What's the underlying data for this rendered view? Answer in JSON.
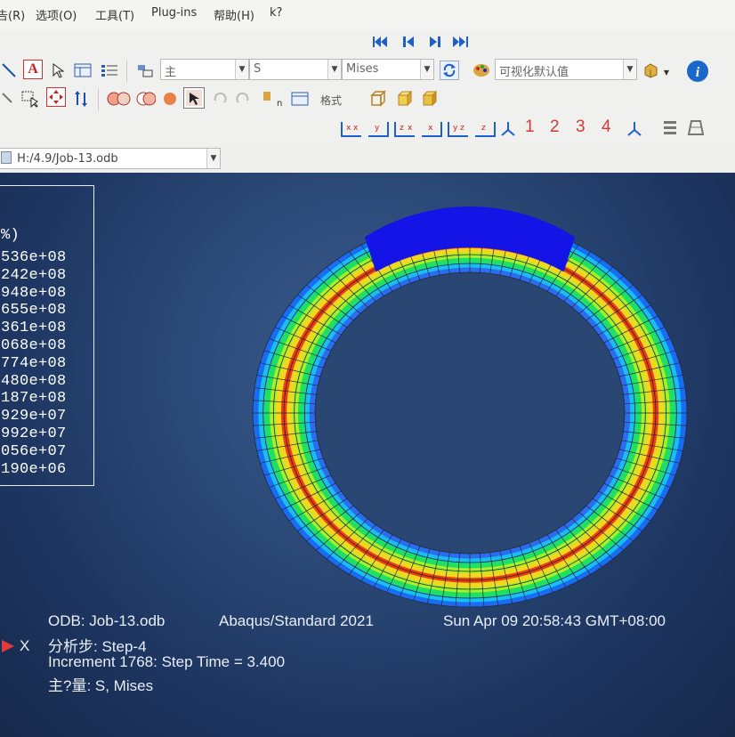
{
  "menubar": {
    "items": [
      "告(R)",
      "选项(O)",
      "工具(T)",
      "Plug-ins",
      "帮助(H)",
      "k?"
    ]
  },
  "toolbar": {
    "results_combo": "主",
    "variable_combo": "S",
    "invariant_combo": "Mises",
    "default_field_combo": "可视化默认值",
    "ghost_label": "格式",
    "view_numbers": [
      "1",
      "2",
      "3",
      "4"
    ]
  },
  "odb_selector": {
    "value": "H:/4.9/Job-13.odb"
  },
  "legend": {
    "header": "%)",
    "values": [
      "536e+08",
      "242e+08",
      "948e+08",
      "655e+08",
      "361e+08",
      "068e+08",
      "774e+08",
      "480e+08",
      "187e+08",
      "929e+07",
      "992e+07",
      "056e+07",
      "190e+06"
    ],
    "colors": [
      "#ff0000",
      "#ff4500",
      "#ff8c00",
      "#ffd000",
      "#e6ff00",
      "#9aff00",
      "#33ff00",
      "#00ff44",
      "#00ffb0",
      "#00d0ff",
      "#0080ff",
      "#0030ff",
      "#0000ff"
    ]
  },
  "viewport_info": {
    "odb_line": "ODB: Job-13.odb",
    "solver_line": "Abaqus/Standard 2021",
    "date_line": "Sun Apr 09 20:58:43 GMT+08:00",
    "step_line": "分析步: Step-4",
    "increment_line": "Increment   1768: Step Time =    3.400",
    "primary_var_line": "主?量: S, Mises",
    "triad_x": "X"
  },
  "ring": {
    "band_colors": [
      "#1a6cf5",
      "#18c0f0",
      "#20e060",
      "#a8f028",
      "#f0d820",
      "#f03c10",
      "#f0d820",
      "#a8f028",
      "#20e060",
      "#18c0f0",
      "#2c6cf0"
    ],
    "contact_color": "#1414e6"
  }
}
